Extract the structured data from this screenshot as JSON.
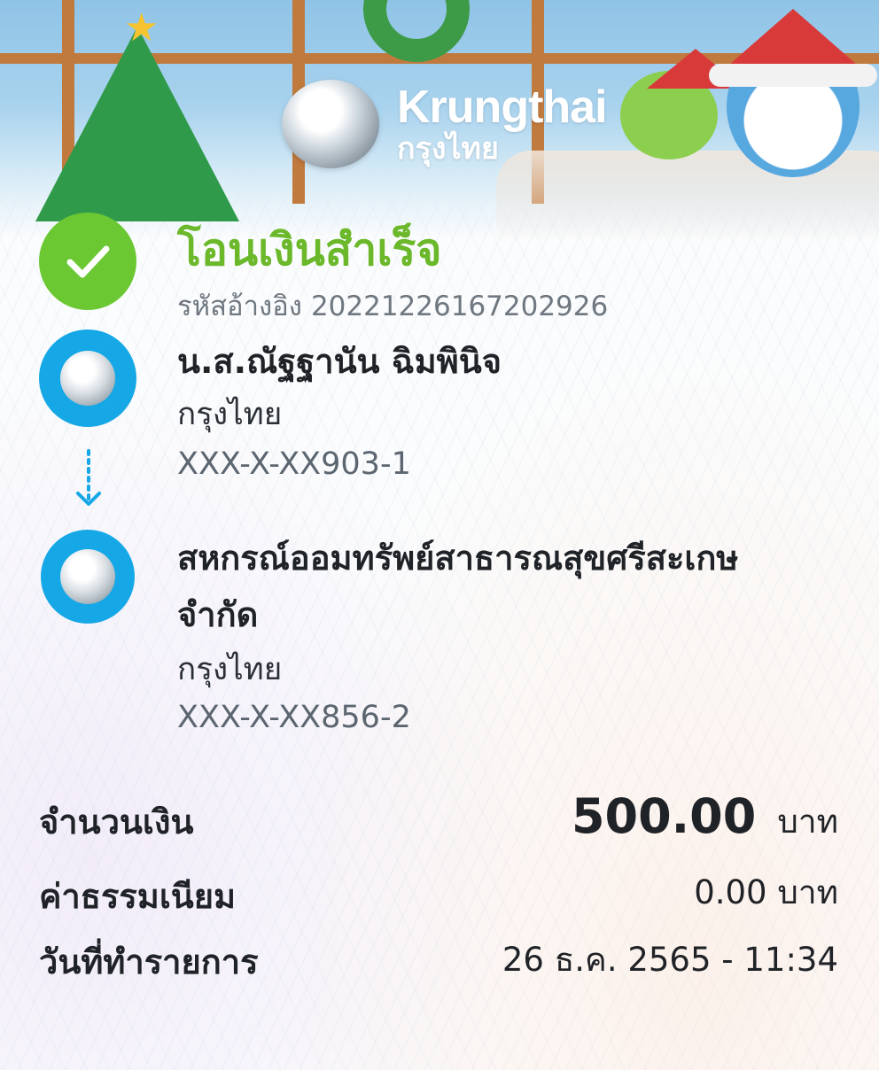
{
  "header": {
    "brand_en": "Krungthai",
    "brand_th": "กรุงไทย"
  },
  "status": {
    "title": "โอนเงินสำเร็จ",
    "ref_label": "รหัสอ้างอิง",
    "ref_value": "20221226167202926",
    "accent_color": "#6bc832"
  },
  "sender": {
    "name": "น.ส.ณัฐฐานัน ฉิมพินิจ",
    "bank": "กรุงไทย",
    "account": "XXX-X-XX903-1"
  },
  "receiver": {
    "name_line1": "สหกรณ์ออมทรัพย์สาธารณสุขศรีสะเกษ",
    "name_line2": "จำกัด",
    "bank": "กรุงไทย",
    "account": "XXX-X-XX856-2"
  },
  "summary": {
    "amount_label": "จำนวนเงิน",
    "amount_value": "500.00",
    "amount_unit": "บาท",
    "fee_label": "ค่าธรรมเนียม",
    "fee_value": "0.00 บาท",
    "date_label": "วันที่ทำรายการ",
    "date_value": "26 ธ.ค. 2565 - 11:34"
  },
  "icons": {
    "success": "check-icon",
    "bank": "krungthai-logo-icon",
    "transfer_arrow": "arrow-down-icon"
  },
  "colors": {
    "bank_blue": "#16a8e6",
    "success_green": "#6bc832",
    "title_green": "#6bb82b"
  }
}
